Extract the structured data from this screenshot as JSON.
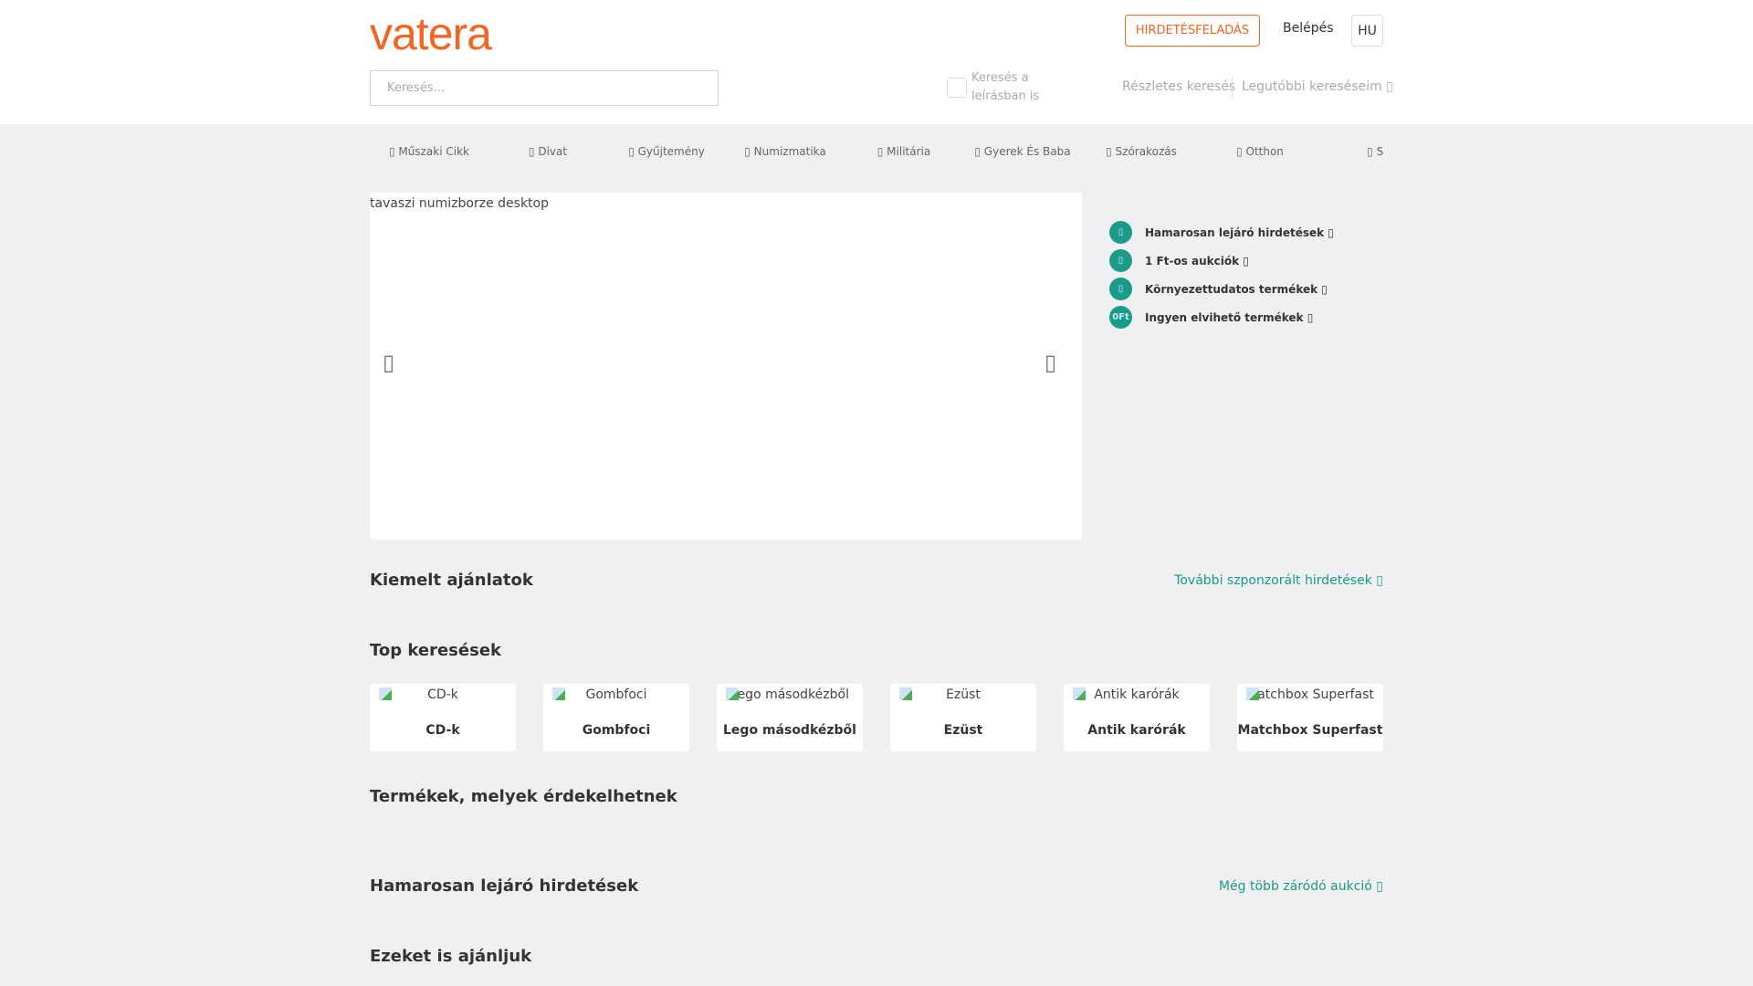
{
  "header": {
    "logo": "vatera",
    "post_ad": "HIRDETÉSFELADÁS",
    "login": "Belépés",
    "language": "HU"
  },
  "search": {
    "placeholder": "Keresés...",
    "desc_label": "Keresés a leírásban is",
    "advanced": "Részletes keresés",
    "recent": "Legutóbbi kereséseim ▯"
  },
  "nav": [
    "▯ Műszaki Cikk",
    "▯ Divat",
    "▯ Gyűjtemény",
    "▯ Numizmatika",
    "▯ Militária",
    "▯ Gyerek És Baba",
    "▯ Szórakozás",
    "▯ Otthon",
    "▯ Sp"
  ],
  "banner": {
    "alt": "tavaszi numizborze desktop",
    "prev": "▯",
    "next": "▯"
  },
  "side_links": [
    {
      "icon": "▯",
      "label": "Hamarosan lejáró hirdetések ▯"
    },
    {
      "icon": "▯",
      "label": "1 Ft-os aukciók ▯"
    },
    {
      "icon": "▯",
      "label": "Környezettudatos termékek ▯"
    },
    {
      "icon": "0Ft",
      "label": "Ingyen elvihető termékek ▯"
    }
  ],
  "sections": {
    "featured": "Kiemelt ajánlatok",
    "featured_more": "További szponzorált hirdetések ▯",
    "top": "Top keresések",
    "interest": "Termékek, melyek érdekelhetnek",
    "ending": "Hamarosan lejáró hirdetések",
    "ending_more": "Még több záródó aukció ▯",
    "recommend": "Ezeket is ajánljuk"
  },
  "top_searches": [
    "CD-k",
    "Gombfoci",
    "Lego másodkézből",
    "Ezüst",
    "Antik karórák",
    "Matchbox Superfast"
  ],
  "colors": {
    "brand": "#f26522",
    "accent": "#1a9b8a"
  }
}
